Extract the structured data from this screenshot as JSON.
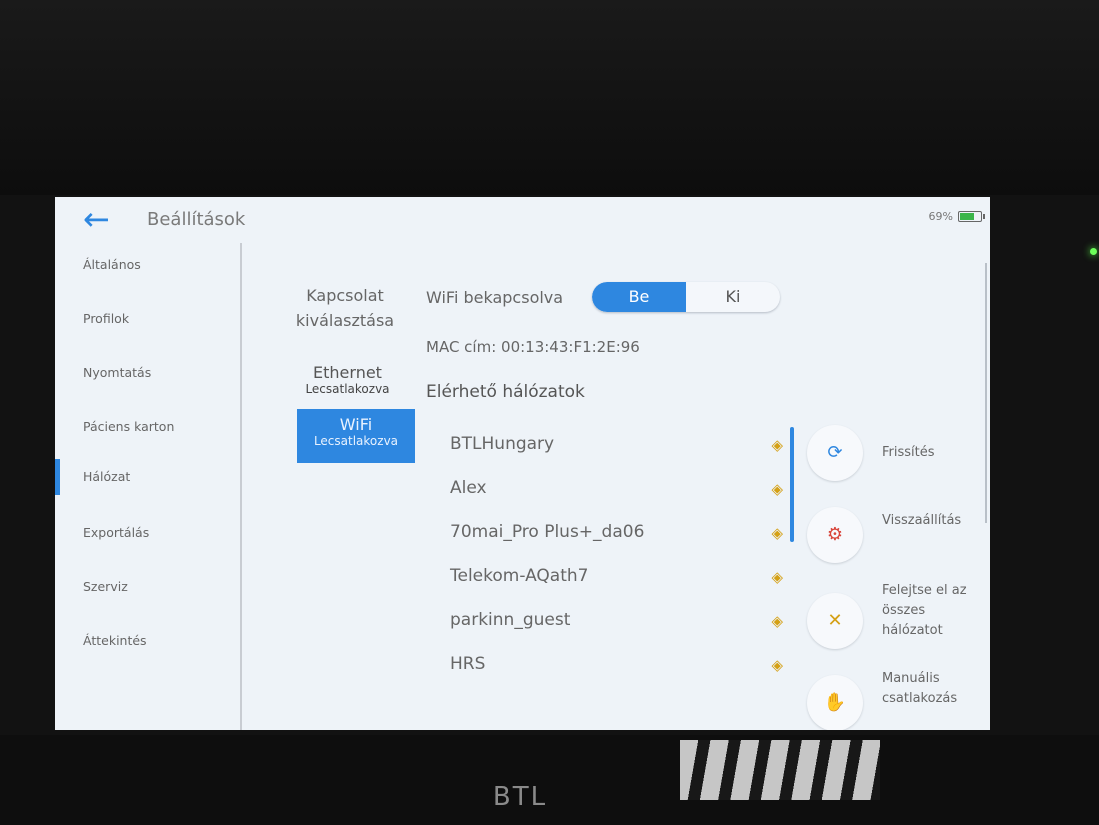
{
  "header": {
    "title": "Beállítások",
    "battery_percent": "69%",
    "battery_level": 0.69
  },
  "sidebar": {
    "items": [
      {
        "label": "Általános"
      },
      {
        "label": "Profilok"
      },
      {
        "label": "Nyomtatás"
      },
      {
        "label": "Páciens karton"
      },
      {
        "label": "Hálózat",
        "active": true
      },
      {
        "label": "Exportálás"
      },
      {
        "label": "Szerviz"
      },
      {
        "label": "Áttekintés"
      }
    ]
  },
  "connection": {
    "label_line1": "Kapcsolat",
    "label_line2": "kiválasztása",
    "options": [
      {
        "name": "Ethernet",
        "status": "Lecsatlakozva"
      },
      {
        "name": "WiFi",
        "status": "Lecsatlakozva",
        "selected": true
      }
    ]
  },
  "wifi": {
    "toggle_label": "WiFi bekapcsolva",
    "on_label": "Be",
    "off_label": "Ki",
    "state": "Be",
    "mac": "MAC cím: 00:13:43:F1:2E:96",
    "available_label": "Elérhető hálózatok",
    "networks": [
      {
        "name": "BTLHungary"
      },
      {
        "name": "Alex"
      },
      {
        "name": "70mai_Pro Plus+_da06"
      },
      {
        "name": "Telekom-AQath7"
      },
      {
        "name": "parkinn_guest"
      },
      {
        "name": "HRS"
      }
    ]
  },
  "actions": [
    {
      "label": "Frissítés",
      "icon": "refresh-wifi-icon"
    },
    {
      "label": "Visszaállítás",
      "icon": "reset-icon"
    },
    {
      "label": "Felejtse el az összes hálózatot",
      "icon": "forget-wifi-icon"
    },
    {
      "label": "Manuális csatlakozás",
      "icon": "manual-connect-icon"
    }
  ],
  "device": {
    "brand": "BTL"
  },
  "colors": {
    "accent": "#2e87e0",
    "wifi_signal": "#d4a015",
    "screen_bg": "#eef3f8"
  }
}
